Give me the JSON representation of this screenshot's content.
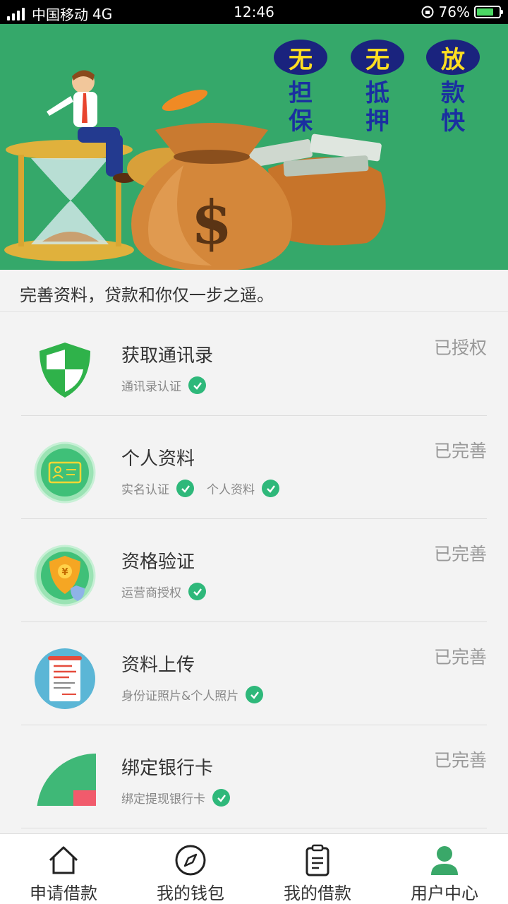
{
  "status_bar": {
    "carrier": "中国移动",
    "network": "4G",
    "time": "12:46",
    "battery": "76%",
    "battery_level": 0.76
  },
  "banner": {
    "slogans": [
      {
        "badge": "无",
        "text": "担保"
      },
      {
        "badge": "无",
        "text": "抵押"
      },
      {
        "badge": "放",
        "text": "款快"
      }
    ],
    "money_symbol": "$"
  },
  "tagline": "完善资料，贷款和你仅一步之遥。",
  "items": [
    {
      "title": "获取通讯录",
      "status": "已授权",
      "tags": [
        "通讯录认证"
      ],
      "icon": "shield-icon"
    },
    {
      "title": "个人资料",
      "status": "已完善",
      "tags": [
        "实名认证",
        "个人资料"
      ],
      "icon": "id-card-icon"
    },
    {
      "title": "资格验证",
      "status": "已完善",
      "tags": [
        "运营商授权"
      ],
      "icon": "yuan-shield-icon"
    },
    {
      "title": "资料上传",
      "status": "已完善",
      "tags": [
        "身份证照片&个人照片"
      ],
      "icon": "document-upload-icon"
    },
    {
      "title": "绑定银行卡",
      "status": "已完善",
      "tags": [
        "绑定提现银行卡"
      ],
      "icon": "bank-card-icon"
    }
  ],
  "nav": [
    {
      "label": "申请借款",
      "icon": "home-icon"
    },
    {
      "label": "我的钱包",
      "icon": "compass-icon"
    },
    {
      "label": "我的借款",
      "icon": "clipboard-icon"
    },
    {
      "label": "用户中心",
      "icon": "user-icon",
      "active": true
    }
  ],
  "colors": {
    "brand_green": "#35a86a",
    "check_green": "#2eb87a",
    "slogan_badge": "#1a237e",
    "slogan_text": "#1a2fa0"
  }
}
